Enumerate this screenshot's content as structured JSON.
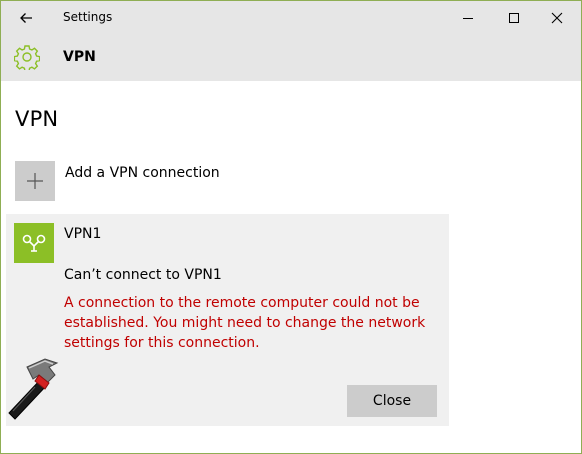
{
  "window": {
    "title": "Settings",
    "controls": {
      "minimize": "minimize-icon",
      "maximize": "maximize-icon",
      "close": "close-icon"
    }
  },
  "header": {
    "icon": "gear-icon",
    "title": "VPN"
  },
  "page": {
    "title": "VPN"
  },
  "add_connection": {
    "icon": "plus-icon",
    "label": "Add a VPN connection"
  },
  "vpn_connection": {
    "icon": "vpn-icon",
    "name": "VPN1",
    "status": "Can’t connect to VPN1",
    "error": "A connection to the remote computer could not be established.  You might need to change the network settings for this connection.",
    "close_label": "Close"
  },
  "colors": {
    "accent": "#8cbf26",
    "error": "#c00000",
    "titlebar": "#e6e6e6",
    "card": "#f0f0f0",
    "tile_gray": "#cccccc"
  }
}
